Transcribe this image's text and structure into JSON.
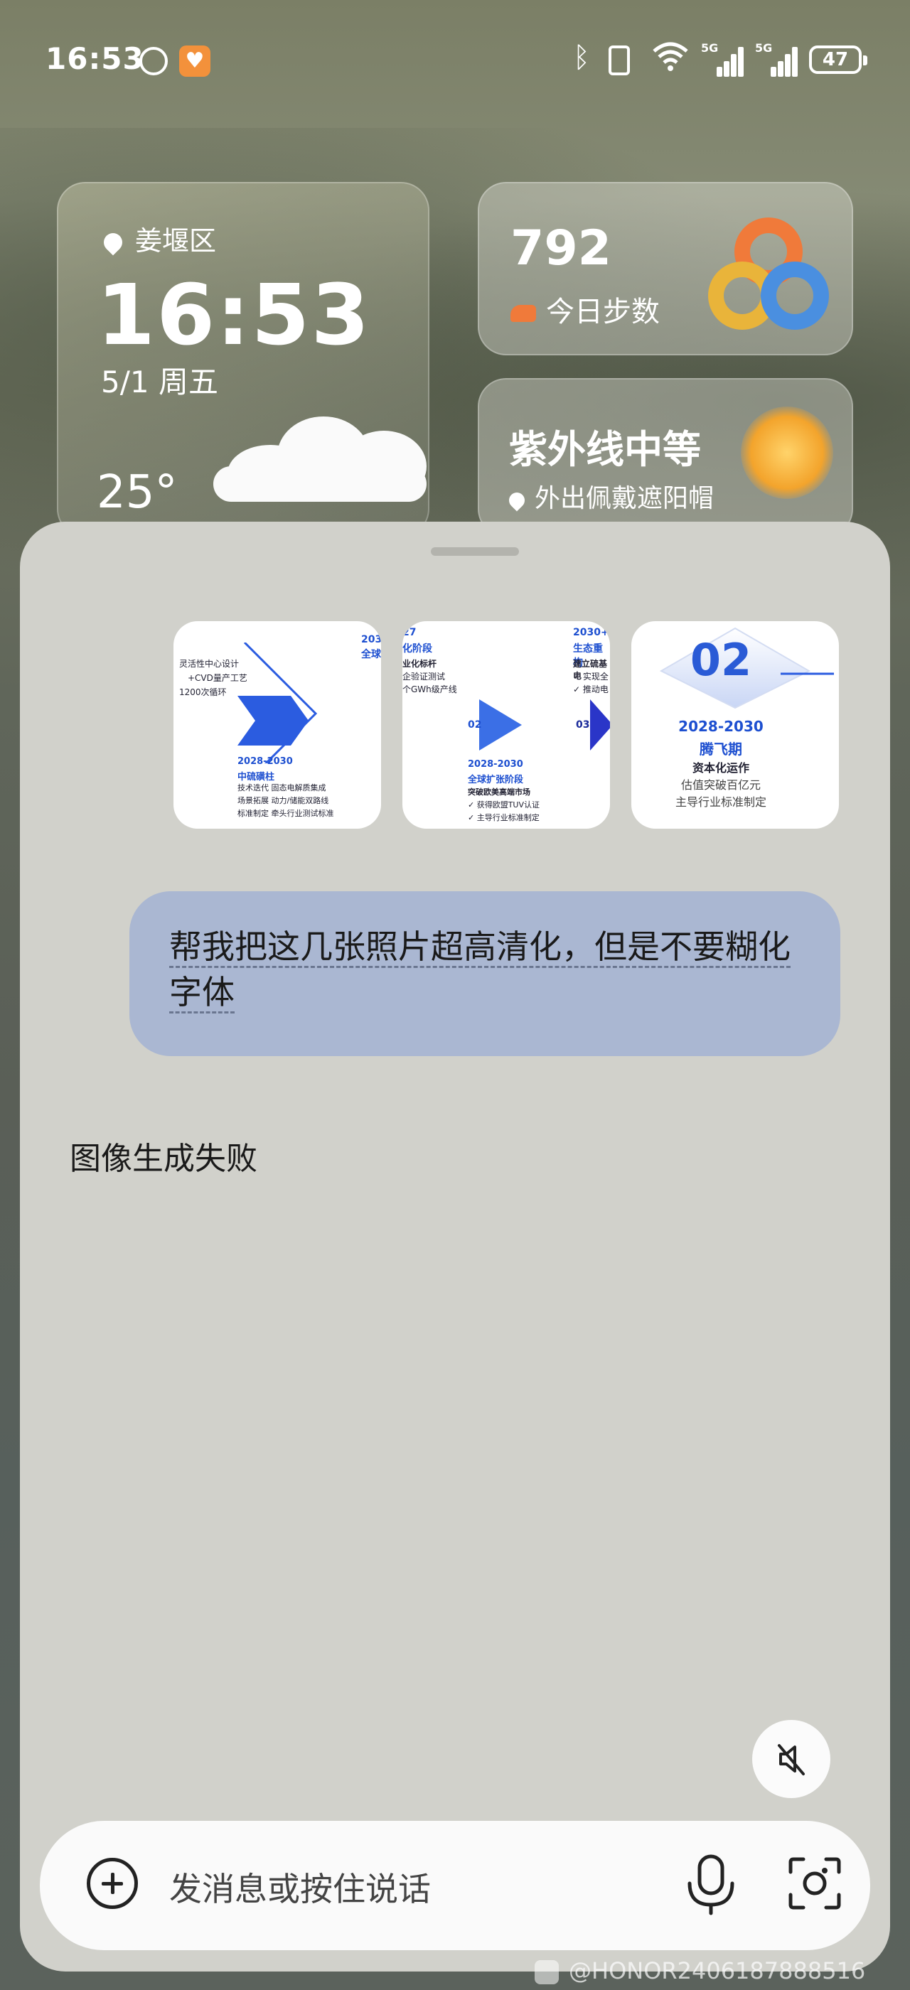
{
  "status_bar": {
    "time": "16:53",
    "battery": "47"
  },
  "widgets": {
    "weather": {
      "location": "姜堰区",
      "time": "16:53",
      "date": "5/1 周五",
      "temperature": "25°"
    },
    "steps": {
      "count": "792",
      "label": "今日步数"
    },
    "uv": {
      "title": "紫外线中等",
      "advice": "外出佩戴遮阳帽"
    }
  },
  "chat": {
    "thumbnails": [
      {
        "texts": [
          "灵活性中心设计",
          "+CVD量产工艺",
          "1200次循环",
          "2028-2030",
          "中硫磺柱",
          "技术迭代  固态电解质集成",
          "场景拓展  动力/储能双路线",
          "标准制定  牵头行业测试标准",
          "203",
          "全球"
        ]
      },
      {
        "texts": [
          "27",
          "化阶段",
          "业化标杆",
          "企验证测试",
          "个GWh级产线",
          "02",
          "03",
          "2028-2030",
          "全球扩张阶段",
          "突破欧美高端市场",
          "✓ 获得欧盟TUV认证",
          "✓ 主导行业标准制定",
          "2030+",
          "生态重构",
          "建立硫基电",
          "✓ 实现全",
          "✓ 推动电"
        ]
      },
      {
        "texts": [
          "02",
          "2028-2030",
          "腾飞期",
          "资本化运作",
          "估值突破百亿元",
          "主导行业标准制定"
        ]
      }
    ],
    "user_message": "帮我把这几张照片超高清化，但是不要糊化字体",
    "assistant_reply": "图像生成失败"
  },
  "input": {
    "placeholder": "发消息或按住说话"
  },
  "watermark": "@HONOR2406187888516",
  "colors": {
    "bubble": "#aab7d2",
    "panel": "#d1d1cb",
    "accent": "#2b5ce0"
  }
}
